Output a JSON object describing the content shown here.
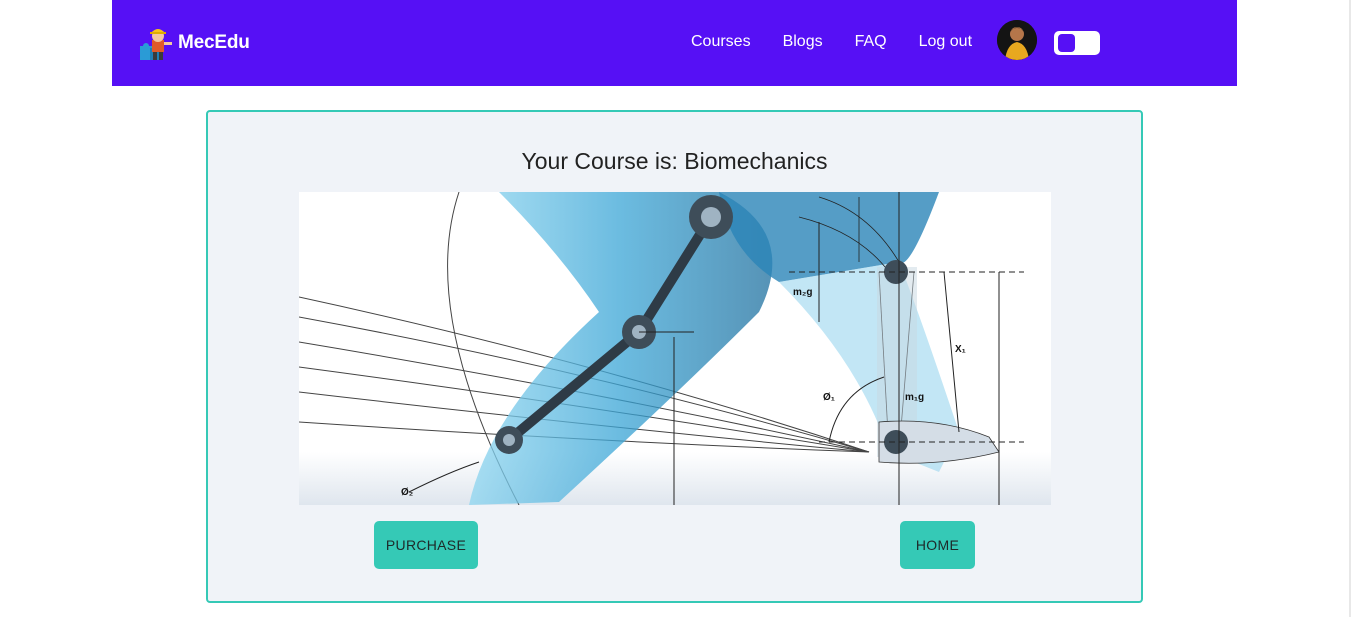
{
  "brand": {
    "name": "MecEdu",
    "logo_icon": "engineer-puzzle-logo-icon"
  },
  "nav": {
    "items": [
      {
        "label": "Courses"
      },
      {
        "label": "Blogs"
      },
      {
        "label": "FAQ"
      },
      {
        "label": "Log out"
      }
    ],
    "avatar_icon": "user-avatar",
    "theme_toggle_icon": "theme-toggle"
  },
  "colors": {
    "navbar": "#5610f5",
    "accent": "#35c9b6",
    "card_bg": "#f0f3f8"
  },
  "course": {
    "title": "Your Course is: Biomechanics",
    "image_icon": "biomechanics-leg-illustration",
    "image_labels": {
      "m2g": "m₂g",
      "m1g": "m₁g",
      "x1": "X₁",
      "phi1": "Ø₁",
      "phi2": "Ø₂"
    },
    "purchase_label": "PURCHASE",
    "home_label": "HOME"
  }
}
